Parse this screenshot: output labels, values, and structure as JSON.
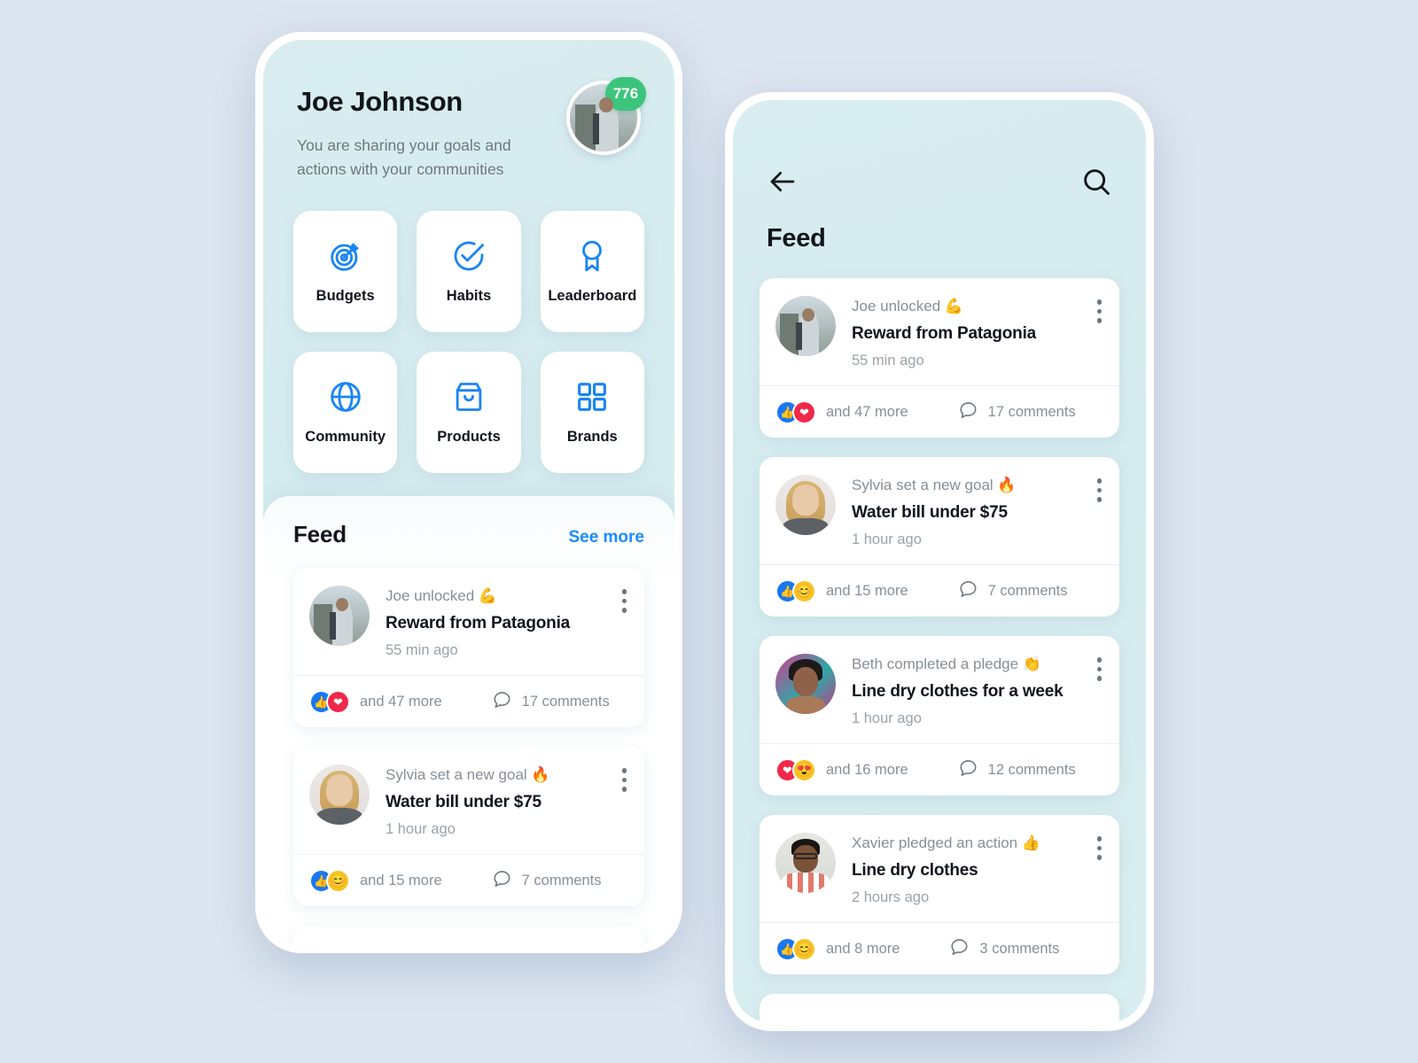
{
  "theme": {
    "page_bg": "#dce5f0",
    "screen_bg": "#d6ecef",
    "accent_blue": "#1a85f5",
    "link_blue": "#1a8cff",
    "badge_green": "#3cc47c",
    "like_blue": "#1877f2",
    "heart_red": "#f0284a",
    "emoji_yellow": "#f7c325"
  },
  "left_phone": {
    "profile": {
      "name": "Joe Johnson",
      "subtitle": "You are sharing your goals and actions with your communities",
      "avatar_name": "joe-avatar",
      "points_badge": "776"
    },
    "tiles": [
      {
        "label": "Budgets",
        "icon": "target-icon"
      },
      {
        "label": "Habits",
        "icon": "check-circle-icon"
      },
      {
        "label": "Leaderboard",
        "icon": "award-ribbon-icon"
      },
      {
        "label": "Community",
        "icon": "globe-icon"
      },
      {
        "label": "Products",
        "icon": "shopping-bag-icon"
      },
      {
        "label": "Brands",
        "icon": "grid-icon"
      }
    ],
    "feed": {
      "title": "Feed",
      "see_more": "See more",
      "posts": [
        {
          "avatar": "joe",
          "action": "Joe unlocked 💪",
          "goal": "Reward from Patagonia",
          "time": "55 min ago",
          "reactions": [
            "like",
            "heart"
          ],
          "react_text": "and 47 more",
          "comments": "17 comments"
        },
        {
          "avatar": "sylvia",
          "action": "Sylvia set a new goal 🔥",
          "goal": "Water bill under $75",
          "time": "1 hour ago",
          "reactions": [
            "like",
            "smile"
          ],
          "react_text": "and 15 more",
          "comments": "7 comments"
        }
      ]
    }
  },
  "right_phone": {
    "back_icon": "back-arrow-icon",
    "search_icon": "search-icon",
    "title": "Feed",
    "posts": [
      {
        "avatar": "joe",
        "action": "Joe unlocked 💪",
        "goal": "Reward from Patagonia",
        "time": "55 min ago",
        "reactions": [
          "like",
          "heart"
        ],
        "react_text": "and 47 more",
        "comments": "17 comments"
      },
      {
        "avatar": "sylvia",
        "action": "Sylvia set a new goal 🔥",
        "goal": "Water bill under $75",
        "time": "1 hour ago",
        "reactions": [
          "like",
          "smile"
        ],
        "react_text": "and 15 more",
        "comments": "7 comments"
      },
      {
        "avatar": "beth",
        "action": "Beth completed a pledge 👏",
        "goal": "Line dry clothes for a week",
        "time": "1 hour ago",
        "reactions": [
          "heart",
          "heart-eyes"
        ],
        "react_text": "and 16 more",
        "comments": "12 comments"
      },
      {
        "avatar": "xavier",
        "action": "Xavier pledged an action 👍",
        "goal": "Line dry clothes",
        "time": "2 hours ago",
        "reactions": [
          "like",
          "smile"
        ],
        "react_text": "and 8 more",
        "comments": "3 comments"
      }
    ]
  }
}
